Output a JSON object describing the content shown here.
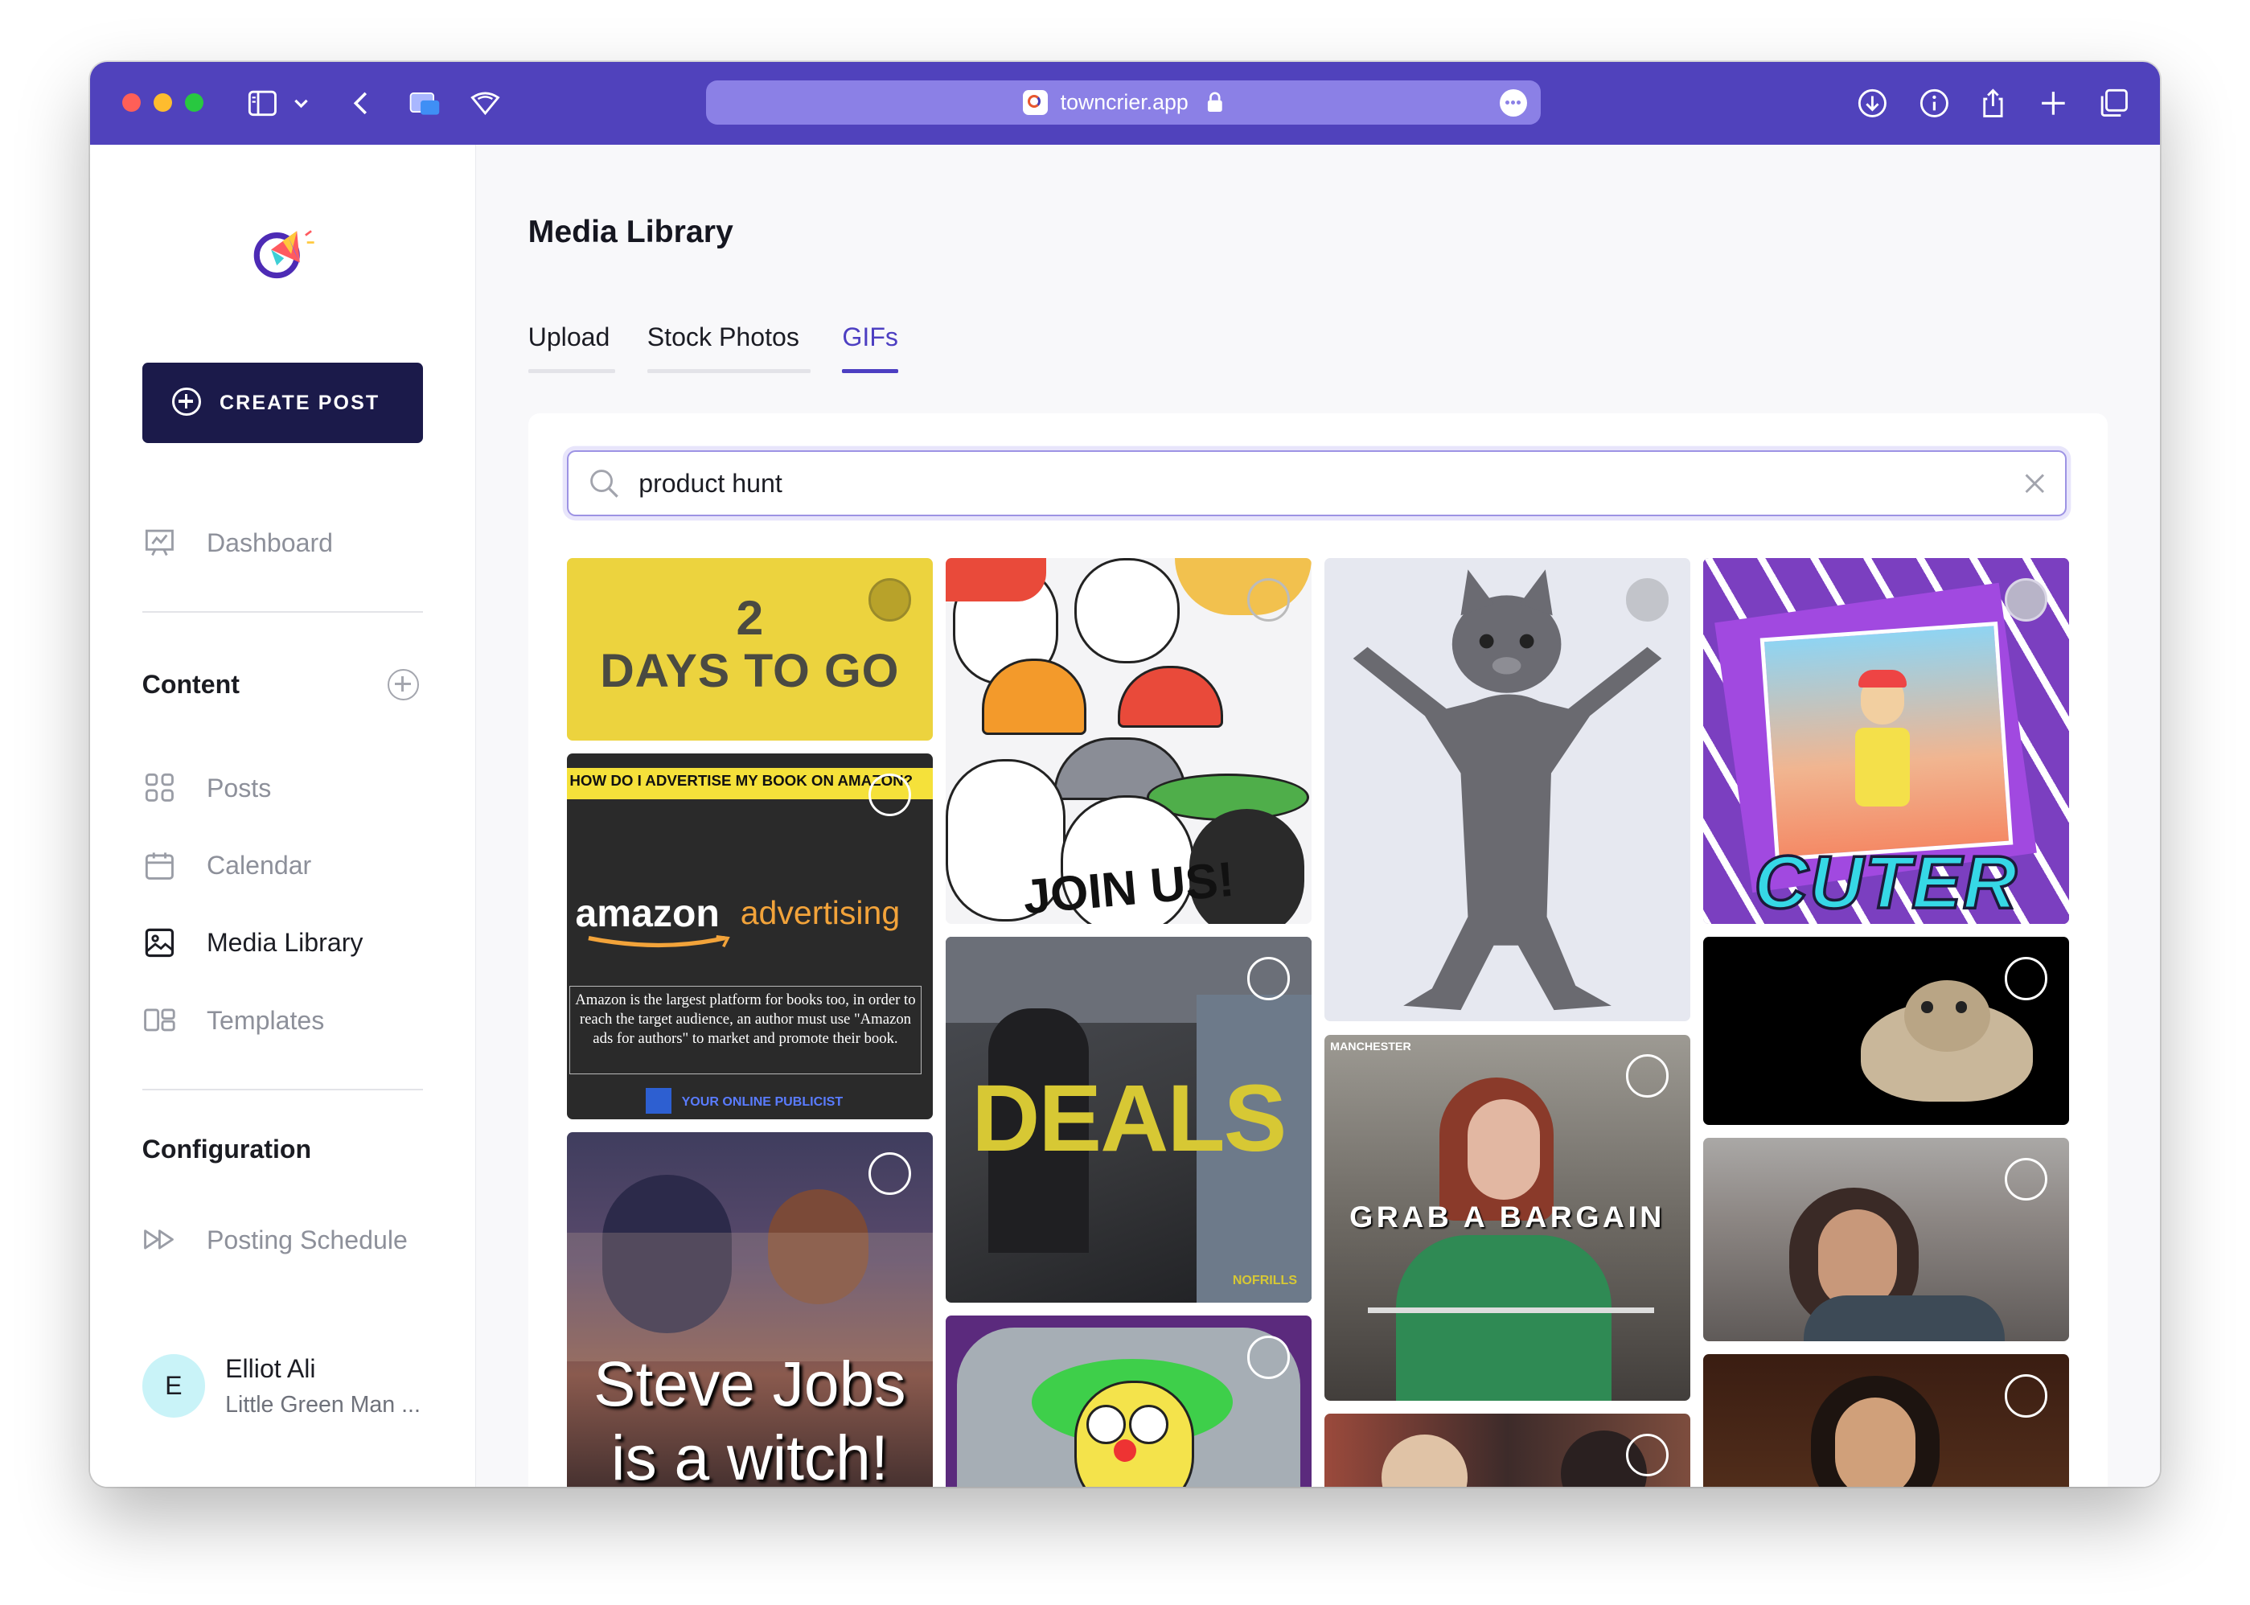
{
  "browser": {
    "url": "towncrier.app",
    "colors": {
      "titlebar": "#5042bc",
      "urlbar": "#8b80e6"
    }
  },
  "sidebar": {
    "create_label": "CREATE POST",
    "dashboard": "Dashboard",
    "content_title": "Content",
    "items": [
      {
        "label": "Posts",
        "icon": "grid-icon"
      },
      {
        "label": "Calendar",
        "icon": "calendar-icon"
      },
      {
        "label": "Media Library",
        "icon": "image-icon",
        "active": true
      },
      {
        "label": "Templates",
        "icon": "templates-icon"
      }
    ],
    "config_title": "Configuration",
    "posting_schedule": "Posting Schedule",
    "user": {
      "initial": "E",
      "name": "Elliot Ali",
      "org": "Little Green Man ..."
    }
  },
  "main": {
    "title": "Media Library",
    "tabs": [
      {
        "label": "Upload"
      },
      {
        "label": "Stock Photos"
      },
      {
        "label": "GIFs",
        "active": true
      }
    ],
    "search": {
      "value": "product hunt"
    },
    "accent": "#4d3fc2",
    "gifs": {
      "days_num": "2",
      "days_text": "DAYS TO GO",
      "amazon_header": "HOW DO I ADVERTISE MY BOOK ON AMAZON?",
      "amazon_brand": "amazon",
      "amazon_sub": "advertising",
      "amazon_body": "Amazon is the largest platform for books too, in order to reach the target audience, an author must use \"Amazon ads for authors\" to market and promote their book.",
      "amazon_footer": "YOUR ONLINE PUBLICIST",
      "steve_line1": "Steve Jobs",
      "steve_line2": "is a witch!",
      "join": "JOIN US!",
      "deals": "DEALS",
      "deals_brand": "NOFRILLS",
      "bargain": "GRAB A BARGAIN",
      "manchester": "MANCHESTER",
      "cuter": "CUTER"
    }
  }
}
